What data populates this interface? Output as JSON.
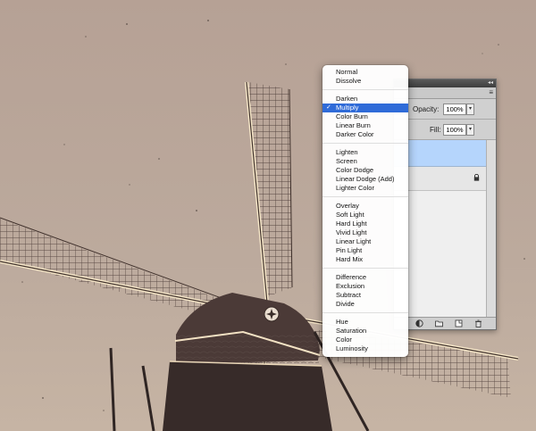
{
  "blend_menu": {
    "groups": [
      [
        "Normal",
        "Dissolve"
      ],
      [
        "Darken",
        "Multiply",
        "Color Burn",
        "Linear Burn",
        "Darker Color"
      ],
      [
        "Lighten",
        "Screen",
        "Color Dodge",
        "Linear Dodge (Add)",
        "Lighter Color"
      ],
      [
        "Overlay",
        "Soft Light",
        "Hard Light",
        "Vivid Light",
        "Linear Light",
        "Pin Light",
        "Hard Mix"
      ],
      [
        "Difference",
        "Exclusion",
        "Subtract",
        "Divide"
      ],
      [
        "Hue",
        "Saturation",
        "Color",
        "Luminosity"
      ]
    ],
    "selected": "Multiply",
    "check_mark": "✓"
  },
  "layers_panel": {
    "opacity_label": "Opacity:",
    "opacity_value": "100%",
    "fill_label": "Fill:",
    "fill_value": "100%",
    "selected_layer_color": "#b5d5fc"
  },
  "icons": {
    "lock": "lock-icon",
    "footer": [
      "adjustment-layer-icon",
      "group-icon",
      "new-layer-icon",
      "trash-icon"
    ]
  },
  "canvas": {
    "sky_color": "#b9a79c",
    "windmill_color": "#3a2f2d"
  }
}
